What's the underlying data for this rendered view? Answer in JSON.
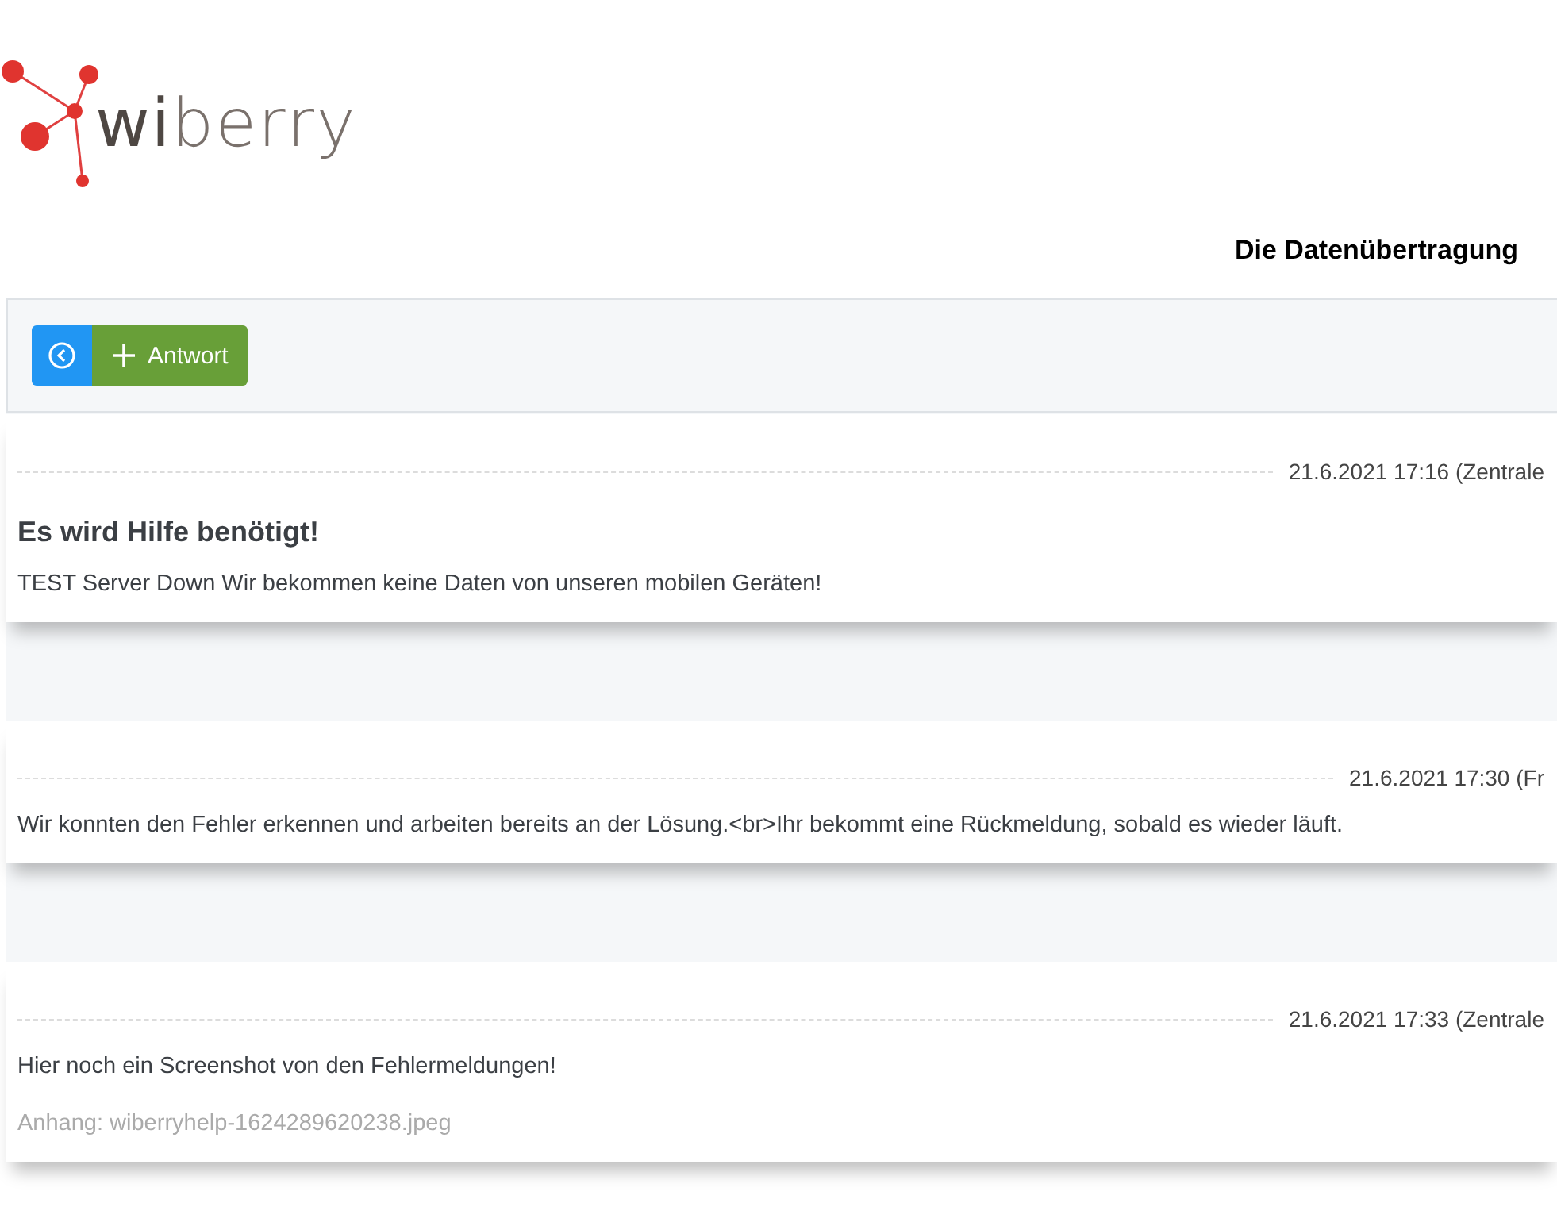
{
  "logo": {
    "text": "**wi**berry"
  },
  "title": "Die Datenübertragung",
  "toolbar": {
    "buttons": [
      {
        "kind": "back"
      },
      {
        "kind": "add",
        "label": "Antwort"
      }
    ]
  },
  "messages": [
    {
      "date": "21.6.2021 17:16 (Zentrale",
      "subject": "Es wird Hilfe benötigt!",
      "body": "TEST Server Down Wir bekommen keine Daten von unseren mobilen Geräten!"
    },
    {
      "date": "21.6.2021 17:30 (Fr",
      "body": "Wir konnten den Fehler erkennen und arbeiten bereits an der Lösung.<br>Ihr bekommt eine Rückmeldung, sobald es wieder läuft."
    },
    {
      "date": "21.6.2021 17:33 (Zentrale",
      "body": "Hier noch ein Screenshot von den Fehlermeldungen!",
      "attachment": "Anhang: wiberryhelp-1624289620238.jpeg"
    }
  ]
}
